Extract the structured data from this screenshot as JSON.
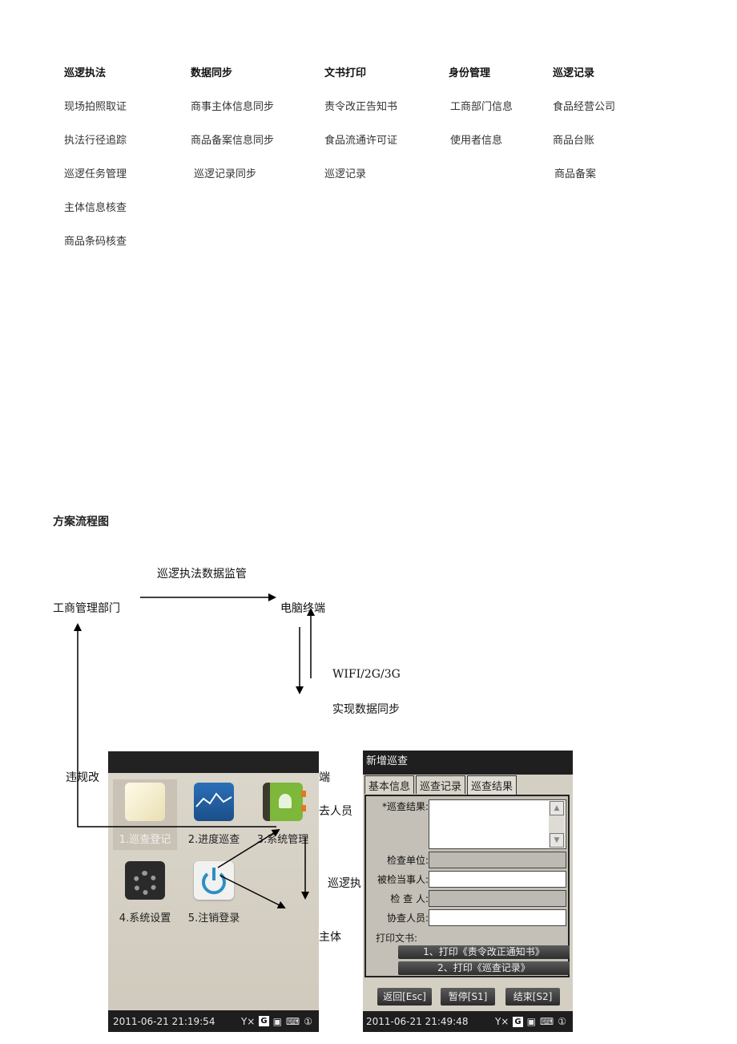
{
  "menu_table": {
    "columns": [
      {
        "header": "巡逻执法",
        "items": [
          "现场拍照取证",
          "执法行径追踪",
          "巡逻任务管理",
          "主体信息核查",
          "商品条码核查"
        ]
      },
      {
        "header": "数据同步",
        "items": [
          "商事主体信息同步",
          "商品备案信息同步",
          "巡逻记录同步"
        ]
      },
      {
        "header": "文书打印",
        "items": [
          "责令改正告知书",
          "食品流通许可证",
          "巡逻记录"
        ]
      },
      {
        "header": "身份管理",
        "items": [
          "工商部门信息",
          "使用者信息"
        ]
      },
      {
        "header": "巡逻记录",
        "items": [
          "食品经营公司",
          "商品台账",
          "商品备案"
        ]
      }
    ]
  },
  "flow": {
    "section_title": "方案流程图",
    "arrow_label_top": "巡逻执法数据监管",
    "node_left": "工商管理部门",
    "node_right": "电脑终端",
    "network_label": "WIFI/2G/3G",
    "sync_label": "实现数据同步",
    "partial_left": "违规改",
    "partial_right_1": "端",
    "partial_right_2": "去人员",
    "partial_right_3": "巡逻执",
    "partial_right_4": "主体"
  },
  "phone_menu": {
    "tiles": [
      {
        "label": "1.巡查登记",
        "icon": "notepad-icon",
        "selected": true
      },
      {
        "label": "2.进度巡查",
        "icon": "chart-icon",
        "selected": false
      },
      {
        "label": "3.系统管理",
        "icon": "contacts-book-icon",
        "selected": false
      },
      {
        "label": "4.系统设置",
        "icon": "gear-icon",
        "selected": false
      },
      {
        "label": "5.注销登录",
        "icon": "power-icon",
        "selected": false
      }
    ],
    "status": {
      "datetime": "2011-06-21 21:19:54",
      "signal": "Y×",
      "network": "G",
      "slot": "①"
    }
  },
  "phone_form": {
    "title": "新增巡查",
    "tabs": [
      "基本信息",
      "巡查记录",
      "巡查结果"
    ],
    "active_tab": 2,
    "fields": {
      "result_label": "*巡查结果:",
      "unit_label": "检查单位:",
      "party_label": "被检当事人:",
      "inspector_label": "检 查 人:",
      "assist_label": "协查人员:",
      "print_label": "打印文书:"
    },
    "print_buttons": [
      "1、打印《责令改正通知书》",
      "2、打印《巡查记录》"
    ],
    "bottom_buttons": [
      "返回[Esc]",
      "暂停[S1]",
      "结束[S2]"
    ],
    "status": {
      "datetime": "2011-06-21 21:49:48",
      "signal": "Y×",
      "network": "G",
      "slot": "①"
    }
  }
}
